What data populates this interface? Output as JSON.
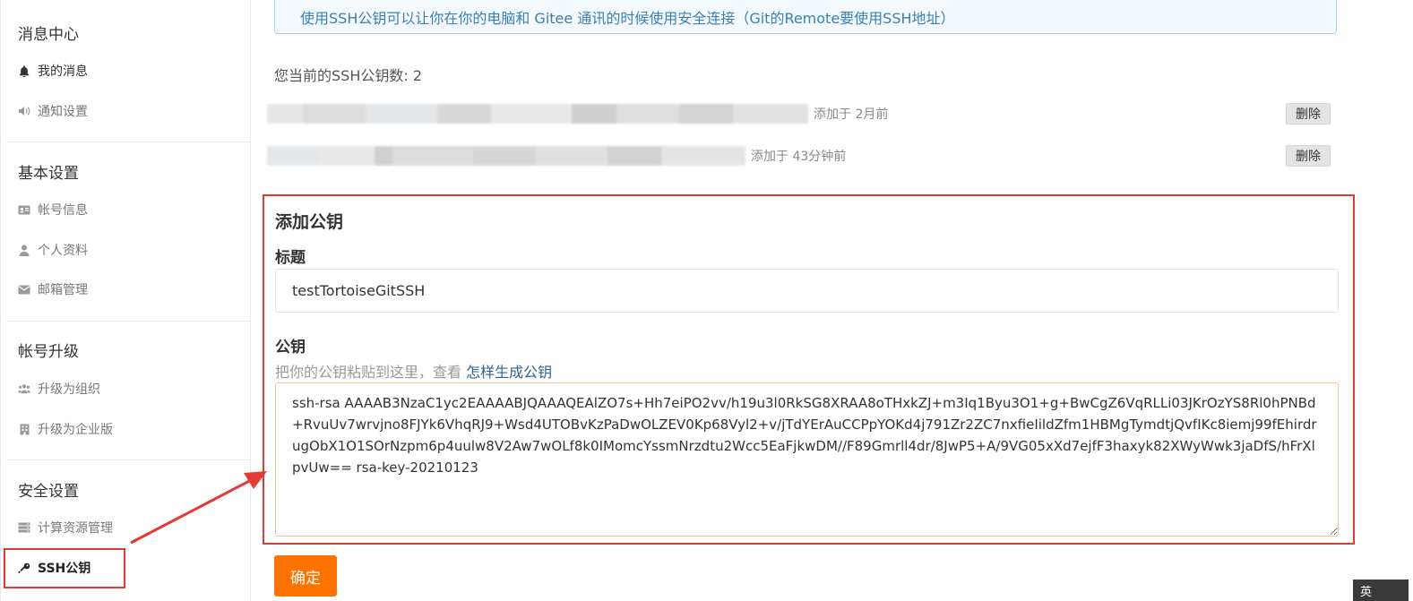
{
  "sidebar": {
    "sections": [
      {
        "title": "消息中心",
        "items": [
          {
            "label": "我的消息",
            "icon": "bell-icon"
          },
          {
            "label": "通知设置",
            "icon": "volume-icon"
          }
        ]
      },
      {
        "title": "基本设置",
        "items": [
          {
            "label": "帐号信息",
            "icon": "id-card-icon"
          },
          {
            "label": "个人资料",
            "icon": "user-icon"
          },
          {
            "label": "邮箱管理",
            "icon": "envelope-icon"
          }
        ]
      },
      {
        "title": "帐号升级",
        "items": [
          {
            "label": "升级为组织",
            "icon": "users-icon"
          },
          {
            "label": "升级为企业版",
            "icon": "building-icon"
          }
        ]
      },
      {
        "title": "安全设置",
        "items": [
          {
            "label": "计算资源管理",
            "icon": "server-icon"
          },
          {
            "label": "SSH公钥",
            "icon": "key-icon"
          }
        ]
      }
    ]
  },
  "main": {
    "info_text": "使用SSH公钥可以让你在你的电脑和 Gitee 通讯的时候使用安全连接（Git的Remote要使用SSH地址）",
    "key_count_text": "您当前的SSH公钥数: 2",
    "keys": [
      {
        "added": "添加于 2月前",
        "delete_label": "删除"
      },
      {
        "added": "添加于 43分钟前",
        "delete_label": "删除"
      }
    ],
    "add_key": {
      "heading": "添加公钥",
      "title_label": "标题",
      "title_value": "testTortoiseGitSSH",
      "key_label": "公钥",
      "hint_prefix": "把你的公钥粘贴到这里，查看",
      "hint_link": "怎样生成公钥",
      "key_value": "ssh-rsa AAAAB3NzaC1yc2EAAAABJQAAAQEAlZO7s+Hh7eiPO2vv/h19u3l0RkSG8XRAA8oTHxkZJ+m3Iq1Byu3O1+g+BwCgZ6VqRLLi03JKrOzYS8Rl0hPNBd+RvuUv7wrvjno8FJYk6VhqRJ9+Wsd4UTOBvKzPaDwOLZEV0Kp68Vyl2+v/jTdYErAuCCPpYOKd4j791Zr2ZC7nxfieIildZfm1HBMgTymdtjQvfIKc8iemj99fEhirdrugObX1O1SOrNzpm6p4uulw8V2Aw7wOLf8k0IMomcYssmNrzdtu2Wcc5EaFjkwDM//F89Gmrll4dr/8JwP5+A/9VG05xXd7ejfF3haxyk82XWyWwk3jaDfS/hFrXlpvUw== rsa-key-20210123"
    },
    "confirm_label": "确定"
  },
  "ime_indicator": "英",
  "colors": {
    "accent": "#fe7300",
    "annotation": "#e53935",
    "link": "#2a6496",
    "info_text": "#3a7fb5"
  }
}
